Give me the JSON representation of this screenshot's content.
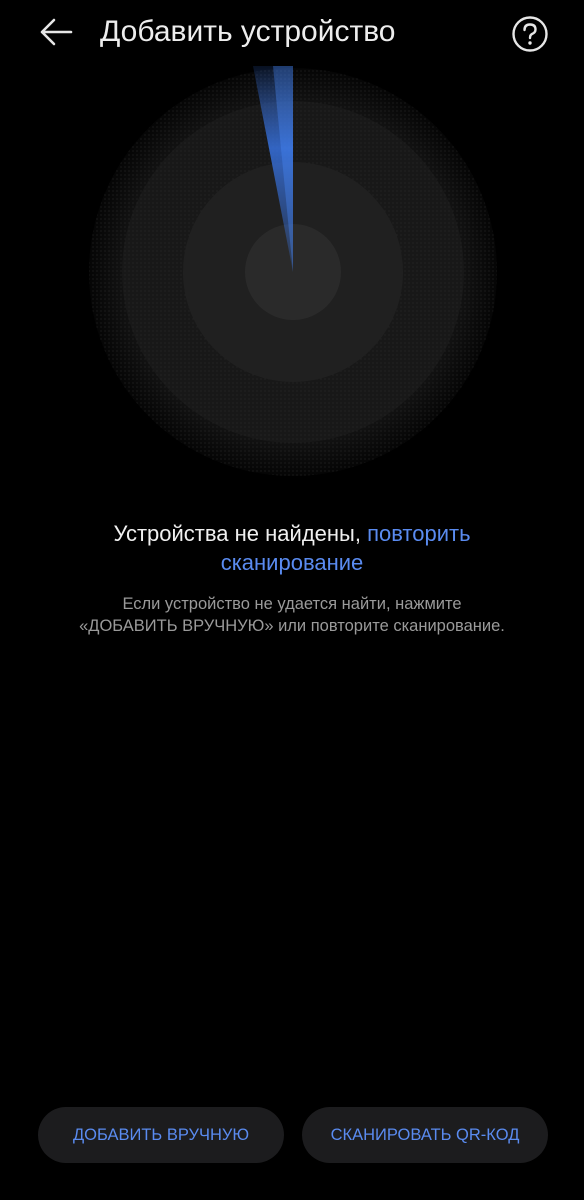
{
  "header": {
    "title": "Добавить устройство",
    "back_icon": "arrow-left-icon",
    "help_icon": "question-circle-icon"
  },
  "scan": {
    "status_text": "Устройства не найдены, ",
    "retry_link_part1": "повторить",
    "retry_link_part2": "сканирование",
    "hint_line1": "Если устройство не удается найти, нажмите",
    "hint_line2": "«ДОБАВИТЬ ВРУЧНУЮ» или повторите сканирование."
  },
  "actions": {
    "add_manually_label": "ДОБАВИТЬ ВРУЧНУЮ",
    "scan_qr_label": "СКАНИРОВАТЬ QR-КОД"
  },
  "colors": {
    "background": "#000000",
    "accent": "#5a8bf0",
    "button_bg": "#1c1c1e",
    "radar_beam": "#3a7bf5"
  }
}
